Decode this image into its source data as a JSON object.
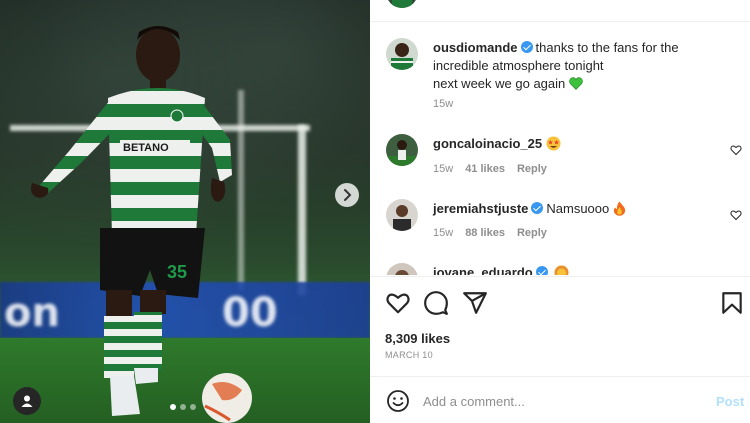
{
  "post": {
    "caption": {
      "username": "ousdiomande",
      "text_line1": "thanks to the fans for the",
      "text_line2": "incredible atmosphere tonight",
      "text_line3": "next week we go again",
      "emoji": "green-heart",
      "time": "15w"
    },
    "comments": [
      {
        "username": "goncaloinacio_25",
        "text": "",
        "emoji": "star-struck",
        "time": "15w",
        "likes": "41 likes",
        "reply": "Reply"
      },
      {
        "username": "jeremiahstjuste",
        "text": "Namsuooo",
        "emoji": "fire",
        "time": "15w",
        "likes": "88 likes",
        "reply": "Reply"
      },
      {
        "username": "iovane_eduardo",
        "text": "",
        "emoji": "lion"
      }
    ],
    "likes_count": "8,309 likes",
    "date": "MARCH 10",
    "comment_placeholder": "Add a comment...",
    "post_label": "Post"
  },
  "media": {
    "board_text_left": "on",
    "board_text_right": "00",
    "jersey_number": "35",
    "sponsor": "BETANO",
    "carousel_dots": 3,
    "active_dot": 0
  },
  "colors": {
    "verified": "#3897f0",
    "post_disabled": "#b2dffc",
    "jersey_green": "#1f7a3a"
  }
}
